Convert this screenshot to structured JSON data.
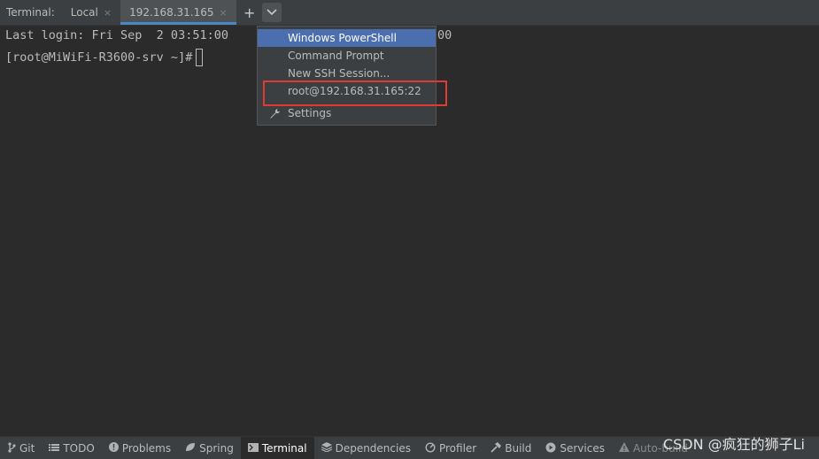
{
  "tabbar": {
    "label": "Terminal:",
    "tabs": [
      {
        "label": "Local",
        "close": "×",
        "active": false
      },
      {
        "label": "192.168.31.165",
        "close": "×",
        "active": true
      }
    ],
    "add_icon": "+",
    "dropdown_icon": "⌄"
  },
  "terminal": {
    "line1": "Last login: Fri Sep  2 03:51:00",
    "line1_tail": "00",
    "line2": "[root@MiWiFi-R3600-srv ~]#"
  },
  "menu": {
    "items": [
      {
        "label": "Windows PowerShell",
        "selected": true
      },
      {
        "label": "Command Prompt"
      },
      {
        "label": "New SSH Session..."
      },
      {
        "label": "root@192.168.31.165:22"
      },
      {
        "label": "Settings",
        "icon": "wrench-icon"
      }
    ],
    "highlight_color": "#e03a35",
    "selected_color": "#4b6eaf"
  },
  "statusbar": {
    "items": [
      {
        "label": "Git",
        "icon": "git-branch-icon"
      },
      {
        "label": "TODO",
        "icon": "list-icon"
      },
      {
        "label": "Problems",
        "icon": "info-icon"
      },
      {
        "label": "Spring",
        "icon": "spring-leaf-icon"
      },
      {
        "label": "Terminal",
        "icon": "terminal-icon",
        "active": true
      },
      {
        "label": "Dependencies",
        "icon": "layers-icon"
      },
      {
        "label": "Profiler",
        "icon": "profiler-icon"
      },
      {
        "label": "Build",
        "icon": "hammer-icon"
      },
      {
        "label": "Services",
        "icon": "services-icon"
      },
      {
        "label": "Auto-build",
        "icon": "warning-icon"
      }
    ]
  },
  "watermark": "CSDN @疯狂的狮子Li"
}
